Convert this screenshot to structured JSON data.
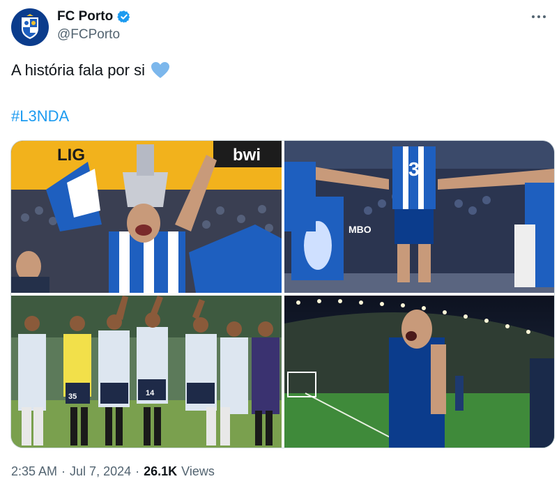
{
  "author": {
    "display_name": "FC Porto",
    "handle": "@FCPorto",
    "verified_icon": "verified-badge-icon",
    "avatar_icon": "fc-porto-crest-icon"
  },
  "tweet": {
    "text": "A história fala por si",
    "emoji_icon": "light-blue-heart-icon",
    "hashtag": "#L3NDA"
  },
  "media": {
    "photo_1_banner": "LIG",
    "photo_1_sponsor": "bwi",
    "photo_2_jersey_number": "3",
    "photo_2_sign": "MBO",
    "photo_3_number_a": "35",
    "photo_3_number_b": "14"
  },
  "meta": {
    "time": "2:35 AM",
    "separator_1": "·",
    "date": "Jul 7, 2024",
    "separator_2": "·",
    "views_count": "26.1K",
    "views_label": "Views"
  },
  "more_icon": "more-horizontal-icon",
  "colors": {
    "accent": "#1d9bf0",
    "porto_blue": "#0b3c8c",
    "text_secondary": "#536471",
    "verified": "#1d9bf0"
  }
}
